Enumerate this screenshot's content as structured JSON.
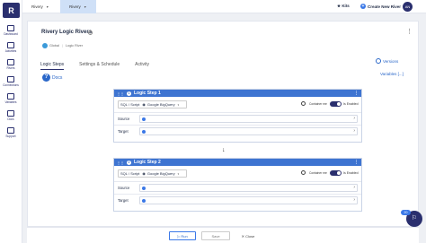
{
  "sidebar": {
    "logo": "R",
    "items": [
      {
        "label": "Dashboard"
      },
      {
        "label": "Activities"
      },
      {
        "label": "Rivers"
      },
      {
        "label": "Connections"
      },
      {
        "label": "Variables"
      },
      {
        "label": "Docs"
      },
      {
        "label": "Support"
      }
    ]
  },
  "topbar": {
    "account_select": "Rivery",
    "env_select": "Rivery",
    "kits": "Kits",
    "create_new": "Create New River",
    "avatar": "AN"
  },
  "page": {
    "title": "Rivery Logic Rivers",
    "breadcrumb_env": "Global",
    "breadcrumb_type": "Logic River",
    "tabs": [
      "Logic Steps",
      "Settings & Schedule",
      "Activity"
    ],
    "versions": "Versions",
    "variables": "Variables [...]",
    "docs": "Docs"
  },
  "steps": [
    {
      "title": "Logic Step 1",
      "num": "1",
      "type": "SQL / Script",
      "target": "Google BigQuery",
      "container_label": "Container me",
      "enabled_label": "Is Enabled",
      "source_label": "Source",
      "target_label": "Target"
    },
    {
      "title": "Logic Step 2",
      "num": "2",
      "type": "SQL / Script",
      "target": "Google BigQuery",
      "container_label": "Container me",
      "enabled_label": "Is Enabled",
      "source_label": "Source",
      "target_label": "Target"
    }
  ],
  "bottom": {
    "run": "Run",
    "save": "Save",
    "close": "Close"
  },
  "chat_badge": "20"
}
